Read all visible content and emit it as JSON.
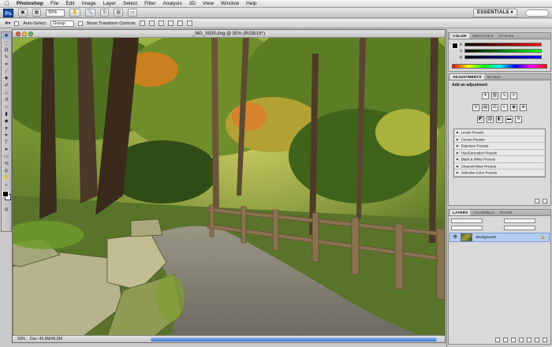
{
  "menubar": {
    "apple": "",
    "app_name": "Photoshop",
    "items": [
      "File",
      "Edit",
      "Image",
      "Layer",
      "Select",
      "Filter",
      "Analysis",
      "3D",
      "View",
      "Window",
      "Help"
    ]
  },
  "appbar": {
    "logo": "Ps",
    "zoom": "50%",
    "workspace": "ESSENTIALS ▾"
  },
  "options_bar": {
    "auto_select_label": "Auto-Select:",
    "auto_select_value": "Group",
    "show_transform_label": "Show Transform Controls"
  },
  "document": {
    "title": "_MG_9939.dng @ 50% (RGB/16*)",
    "zoom": "50%",
    "doc_info": "Doc: 45.6M/45.6M"
  },
  "color_panel": {
    "tabs": [
      "COLOR",
      "SWATCHES",
      "STYLES"
    ],
    "active_tab": "COLOR",
    "channels": [
      "R",
      "G",
      "B"
    ],
    "foreground": "#000000",
    "background": "#ffffff"
  },
  "adjustments_panel": {
    "tabs": [
      "ADJUSTMENTS",
      "MASKS"
    ],
    "active_tab": "ADJUSTMENTS",
    "heading": "Add an adjustment",
    "presets": [
      "Levels Presets",
      "Curves Presets",
      "Exposure Presets",
      "Hue/Saturation Presets",
      "Black & White Presets",
      "Channel Mixer Presets",
      "Selective Color Presets"
    ]
  },
  "layers_panel": {
    "tabs": [
      "LAYERS",
      "CHANNELS",
      "PATHS"
    ],
    "active_tab": "LAYERS",
    "layer_name": "Background",
    "accent": "#b4cdf2"
  }
}
